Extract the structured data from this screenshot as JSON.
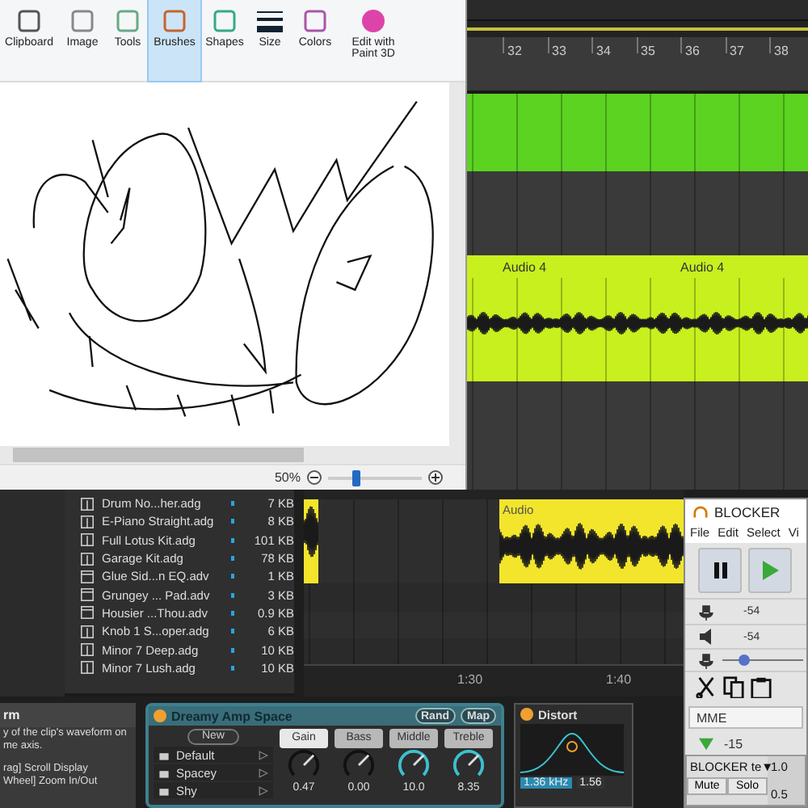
{
  "live": {
    "ruler": [
      "32",
      "33",
      "34",
      "35",
      "36",
      "37",
      "38"
    ],
    "audio_track": {
      "clips": [
        "Audio 4",
        "Audio 4"
      ]
    },
    "browser": {
      "files": [
        {
          "name": "Drum No...her.adg",
          "size": "7 KB",
          "kind": "rack"
        },
        {
          "name": "E-Piano Straight.adg",
          "size": "8 KB",
          "kind": "rack"
        },
        {
          "name": "Full Lotus Kit.adg",
          "size": "101 KB",
          "kind": "rack"
        },
        {
          "name": "Garage Kit.adg",
          "size": "78 KB",
          "kind": "rack"
        },
        {
          "name": "Glue Sid...n EQ.adv",
          "size": "1 KB",
          "kind": "preset"
        },
        {
          "name": "Grungey ... Pad.adv",
          "size": "3 KB",
          "kind": "preset"
        },
        {
          "name": "Housier ...Thou.adv",
          "size": "0.9 KB",
          "kind": "preset"
        },
        {
          "name": "Knob 1 S...oper.adg",
          "size": "6 KB",
          "kind": "rack"
        },
        {
          "name": "Minor 7 Deep.adg",
          "size": "10 KB",
          "kind": "rack"
        },
        {
          "name": "Minor 7 Lush.adg",
          "size": "10 KB",
          "kind": "rack"
        }
      ]
    },
    "lower_clip": {
      "label": "Audio"
    },
    "timeline": [
      "1:30",
      "1:40"
    ],
    "info": {
      "title": "rm",
      "lines": [
        "y of the clip's waveform on",
        "me axis."
      ],
      "shortcuts": [
        "rag] Scroll Display",
        "Wheel] Zoom In/Out"
      ]
    },
    "rack": {
      "title": "Dreamy Amp Space",
      "buttons": [
        "Rand",
        "Map"
      ],
      "new_button": "New",
      "presets": [
        "Default",
        "Spacey",
        "Shy"
      ],
      "knobs": [
        {
          "label": "Gain",
          "value": "0.47",
          "active": false,
          "selected": true
        },
        {
          "label": "Bass",
          "value": "0.00",
          "active": false,
          "selected": false
        },
        {
          "label": "Middle",
          "value": "10.0",
          "active": true,
          "selected": false
        },
        {
          "label": "Treble",
          "value": "8.35",
          "active": true,
          "selected": false
        }
      ]
    },
    "distort": {
      "title": "Distort",
      "freq": "1.36 kHz",
      "q": "1.56"
    }
  },
  "paint": {
    "ribbon": [
      {
        "label": "Clipboard",
        "selected": false
      },
      {
        "label": "Image",
        "selected": false
      },
      {
        "label": "Tools",
        "selected": false
      },
      {
        "label": "Brushes",
        "selected": true
      },
      {
        "label": "Shapes",
        "selected": false
      },
      {
        "label": "Size",
        "selected": false
      },
      {
        "label": "Colors",
        "selected": false
      },
      {
        "label": "Edit with Paint 3D",
        "selected": false
      }
    ],
    "zoom": {
      "label": "50%",
      "level": 0.25
    }
  },
  "audacity": {
    "title": "BLOCKER",
    "menu": [
      "File",
      "Edit",
      "Select",
      "Vi"
    ],
    "meters": [
      "-54",
      "-54"
    ],
    "slider": {
      "level": 0.2
    },
    "host": "MME",
    "gain": "-15",
    "track": {
      "name": "BLOCKER te▼",
      "buttons": [
        "Mute",
        "Solo"
      ],
      "scale": [
        "1.0",
        "0.5"
      ]
    }
  }
}
